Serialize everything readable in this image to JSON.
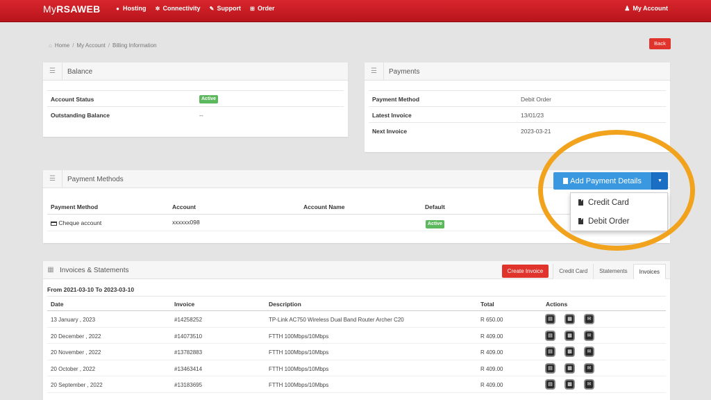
{
  "nav": {
    "logo_my": "My",
    "logo_brand": "RSAWEB",
    "items": [
      {
        "label": "Hosting",
        "icon": "globe-icon",
        "glyph": "●"
      },
      {
        "label": "Connectivity",
        "icon": "network-icon",
        "glyph": "✲"
      },
      {
        "label": "Support",
        "icon": "wrench-icon",
        "glyph": "✎"
      },
      {
        "label": "Order",
        "icon": "cart-icon",
        "glyph": "⊞"
      }
    ],
    "account": "My Account"
  },
  "breadcrumb": [
    "Home",
    "My Account",
    "Billing Information"
  ],
  "back_label": "Back",
  "balance": {
    "title": "Balance",
    "rows": [
      {
        "key": "Account Status",
        "value": "Active",
        "badge": true
      },
      {
        "key": "Outstanding Balance",
        "value": "--",
        "badge": false
      }
    ]
  },
  "payments": {
    "title": "Payments",
    "rows": [
      {
        "key": "Payment Method",
        "value": "Debit Order"
      },
      {
        "key": "Latest Invoice",
        "value": "13/01/23"
      },
      {
        "key": "Next Invoice",
        "value": "2023-03-21"
      }
    ]
  },
  "payment_methods": {
    "title": "Payment Methods",
    "columns": [
      "Payment Method",
      "Account",
      "Account Name",
      "Default"
    ],
    "row": {
      "method": "Cheque account",
      "account": "xxxxxx098",
      "name": "",
      "default": "Active"
    },
    "add_button": "Add Payment Details",
    "menu": [
      "Credit Card",
      "Debit Order"
    ]
  },
  "invoices": {
    "title": "Invoices & Statements",
    "create_button": "Create Invoice",
    "tabs": [
      "Credit Card",
      "Statements",
      "Invoices"
    ],
    "active_tab": "Invoices",
    "range": "From 2021-03-10 To 2023-03-10",
    "columns": [
      "Date",
      "Invoice",
      "Description",
      "Total",
      "Actions"
    ],
    "rows": [
      {
        "date": "13 January , 2023",
        "invoice": "#14258252",
        "description": "TP-Link AC750 Wireless Dual Band Router Archer C20",
        "total": "R 650.00"
      },
      {
        "date": "20 December , 2022",
        "invoice": "#14073510",
        "description": "FTTH 100Mbps/10Mbps",
        "total": "R 409.00"
      },
      {
        "date": "20 November , 2022",
        "invoice": "#13782883",
        "description": "FTTH 100Mbps/10Mbps",
        "total": "R 409.00"
      },
      {
        "date": "20 October , 2022",
        "invoice": "#13463414",
        "description": "FTTH 100Mbps/10Mbps",
        "total": "R 409.00"
      },
      {
        "date": "20 September , 2022",
        "invoice": "#13183695",
        "description": "FTTH 100Mbps/10Mbps",
        "total": "R 409.00"
      }
    ]
  },
  "colors": {
    "brand": "#c8191f",
    "primary": "#3a98e0",
    "danger": "#e0332b",
    "success": "#5cb85c",
    "highlight": "#f2a31d"
  }
}
